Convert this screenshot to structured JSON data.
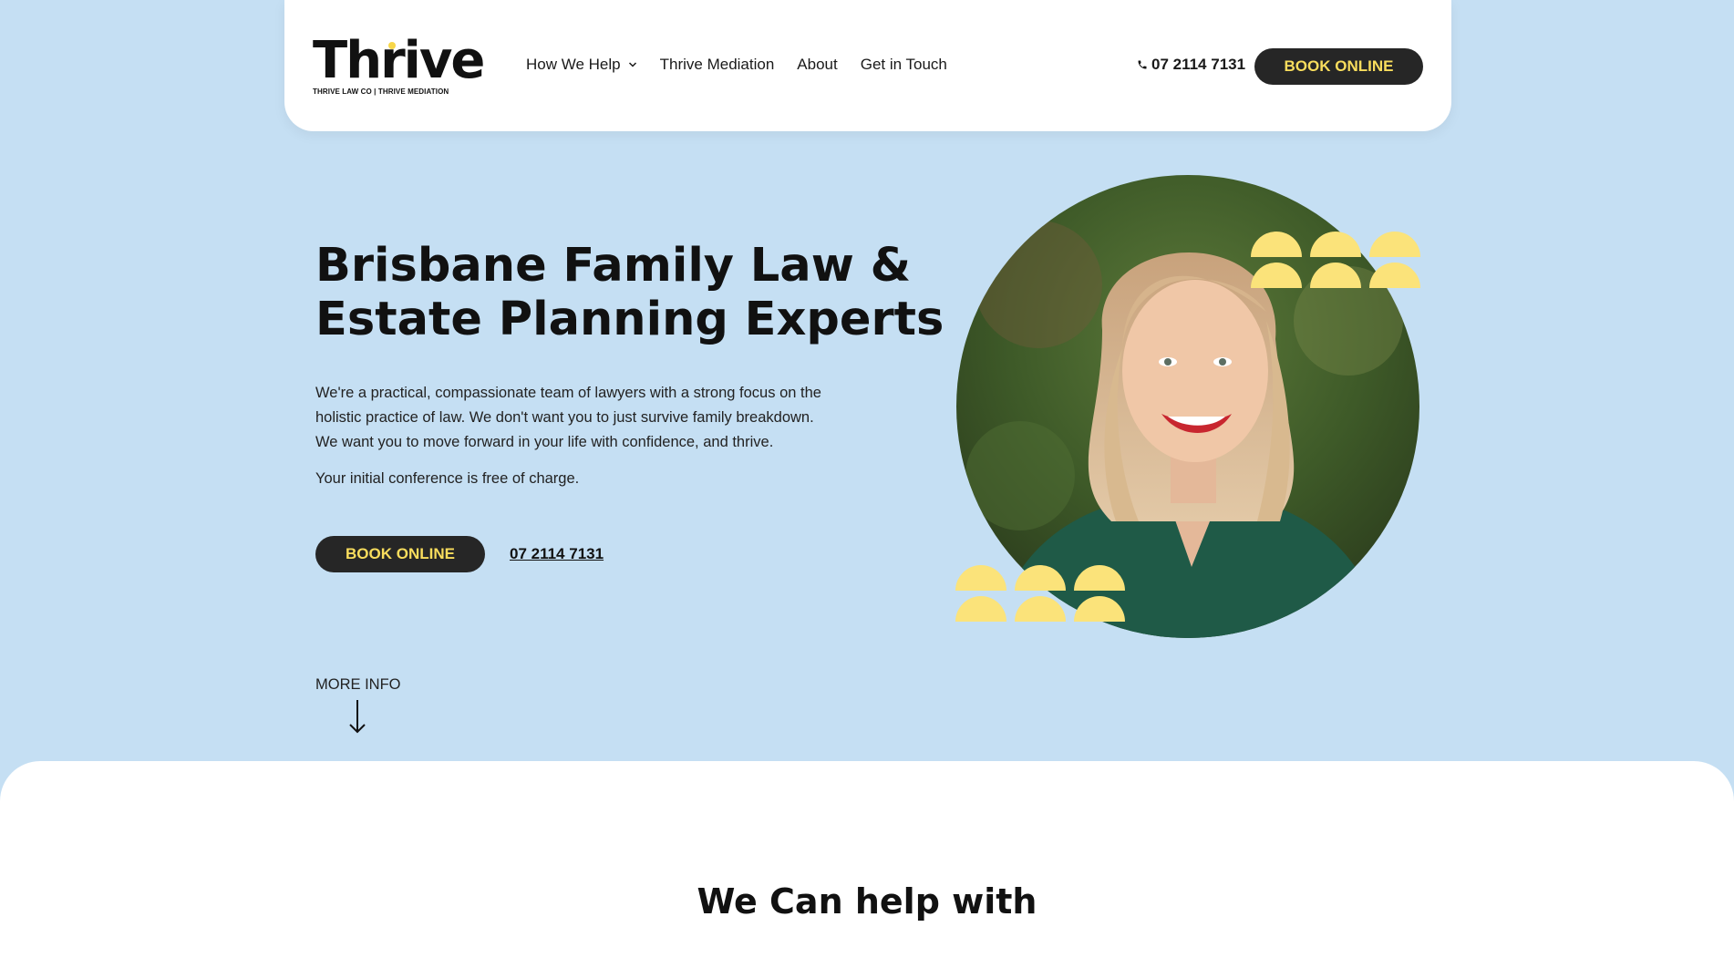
{
  "header": {
    "logo_word": "Thrive",
    "logo_tagline": "THRIVE LAW CO | THRIVE MEDIATION",
    "nav": [
      {
        "label": "How We Help",
        "has_dropdown": true
      },
      {
        "label": "Thrive Mediation"
      },
      {
        "label": "About"
      },
      {
        "label": "Get in Touch"
      }
    ],
    "phone": "07 2114 7131",
    "phone_icon": "phone-icon",
    "book_label": "BOOK ONLINE"
  },
  "hero": {
    "title_lines": [
      "Brisbane Family Law &",
      "Estate Planning Experts"
    ],
    "intro_lines": [
      "We're a practical, compassionate team of lawyers with a strong focus on the",
      "holistic practice of law.  We don't want you to just survive family breakdown.",
      "We want you to move forward in your life with confidence, and thrive."
    ],
    "free_note": "Your initial conference is free of charge.",
    "book_label": "BOOK ONLINE",
    "phone_link": "07 2114 7131",
    "more_info": "MORE INFO"
  },
  "lower": {
    "title": "We Can help with"
  },
  "colors": {
    "page_bg": "#c5dff3",
    "button_bg": "#262626",
    "accent_yellow": "#f9dd5d",
    "decor_yellow": "#fbe37a"
  }
}
